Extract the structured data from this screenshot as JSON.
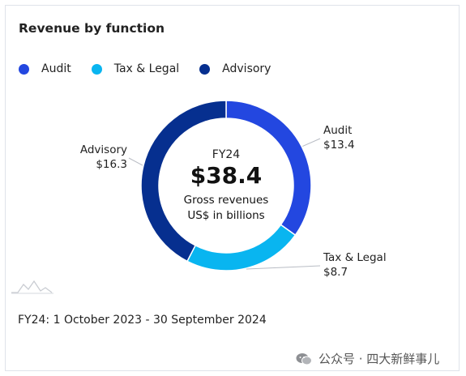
{
  "chart_data": {
    "type": "donut",
    "title": "Revenue by function",
    "categories": [
      "Audit",
      "Tax & Legal",
      "Advisory"
    ],
    "values": [
      13.4,
      8.7,
      16.3
    ],
    "value_labels": [
      "$13.4",
      "$8.7",
      "$16.3"
    ],
    "colors": [
      "#2347e0",
      "#09b5f0",
      "#062f8f"
    ],
    "legend_position": "top-left",
    "center": {
      "period": "FY24",
      "total": "$38.4",
      "line1": "Gross revenues",
      "line2": "US$ in billions"
    }
  },
  "footnote": "FY24: 1 October 2023 - 30 September 2024",
  "watermark": {
    "text": "公众号 · 四大新鲜事儿",
    "icon": "wechat-icon"
  }
}
